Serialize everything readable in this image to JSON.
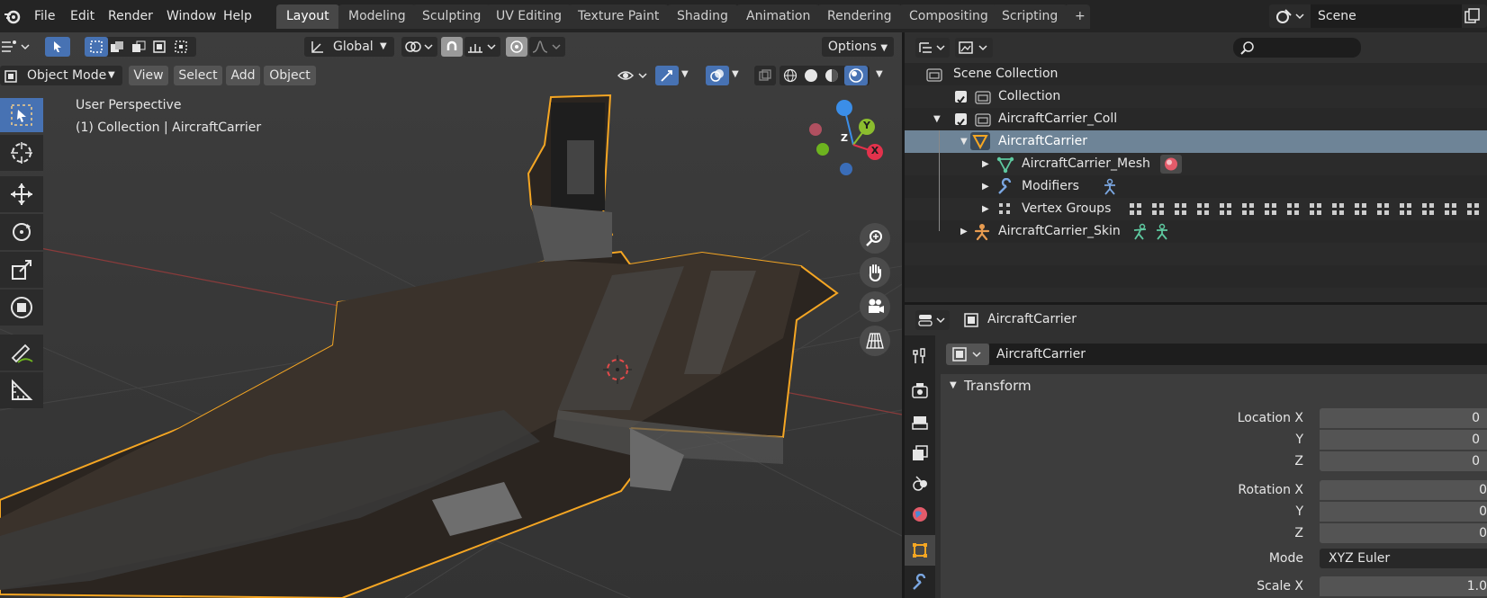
{
  "topbar": {
    "menus": [
      "File",
      "Edit",
      "Render",
      "Window",
      "Help"
    ],
    "workspaces": [
      "Layout",
      "Modeling",
      "Sculpting",
      "UV Editing",
      "Texture Paint",
      "Shading",
      "Animation",
      "Rendering",
      "Compositing",
      "Scripting"
    ],
    "active_workspace": "Layout",
    "add_workspace": "+",
    "scene_name": "Scene"
  },
  "viewport": {
    "transform_orientation": "Global",
    "options_label": "Options",
    "mode": "Object Mode",
    "menus": [
      "View",
      "Select",
      "Add",
      "Object"
    ],
    "overlay_line1": "User Perspective",
    "overlay_line2": "(1) Collection | AircraftCarrier",
    "gizmo": {
      "x": "X",
      "y": "Y",
      "z": "Z"
    }
  },
  "outliner": {
    "rows": [
      {
        "label": "Scene Collection",
        "icon": "scene-collection-icon"
      },
      {
        "label": "Collection",
        "icon": "collection-icon"
      },
      {
        "label": "AircraftCarrier_Coll",
        "icon": "collection-icon"
      },
      {
        "label": "AircraftCarrier",
        "icon": "mesh-object-icon"
      },
      {
        "label": "AircraftCarrier_Mesh",
        "icon": "mesh-data-icon"
      },
      {
        "label": "Modifiers",
        "icon": "wrench-icon"
      },
      {
        "label": "Vertex Groups",
        "icon": "vertex-groups-icon"
      },
      {
        "label": "AircraftCarrier_Skin",
        "icon": "armature-icon"
      }
    ]
  },
  "properties": {
    "header_object": "AircraftCarrier",
    "object_name": "AircraftCarrier",
    "panel_title": "Transform",
    "fields": [
      {
        "label": "Location X",
        "value": "0"
      },
      {
        "label": "Y",
        "value": "0"
      },
      {
        "label": "Z",
        "value": "0"
      },
      {
        "label": "Rotation X",
        "value": "0"
      },
      {
        "label": "Y",
        "value": "0"
      },
      {
        "label": "Z",
        "value": "0"
      },
      {
        "label": "Mode",
        "value": "XYZ Euler"
      },
      {
        "label": "Scale X",
        "value": "1.0"
      }
    ]
  },
  "colors": {
    "accent": "#4772b3",
    "selection_outline": "#f5a623",
    "gizmo_x": "#e3324c",
    "gizmo_y": "#8bbd2e",
    "gizmo_z": "#3b8ee8"
  }
}
